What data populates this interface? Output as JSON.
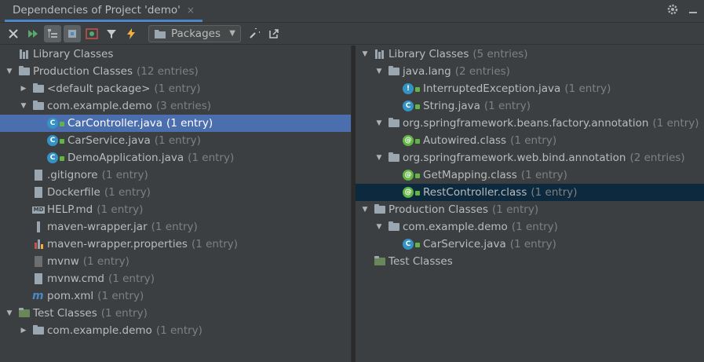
{
  "titlebar": {
    "tab_label": "Dependencies of Project 'demo'",
    "tab_close": "×"
  },
  "toolbar": {
    "scope_label": "Packages"
  },
  "left_tree": [
    {
      "name": "Library Classes",
      "count": "",
      "icon": "library-icon",
      "depth": 0,
      "arrow": ""
    },
    {
      "name": "Production Classes",
      "count": "(12 entries)",
      "icon": "folder-icon",
      "depth": 0,
      "arrow": "down"
    },
    {
      "name": "<default package>",
      "count": "(1 entry)",
      "icon": "package-folder-icon",
      "depth": 1,
      "arrow": "right"
    },
    {
      "name": "com.example.demo",
      "count": "(3 entries)",
      "icon": "package-folder-icon",
      "depth": 1,
      "arrow": "down"
    },
    {
      "name": "CarController.java",
      "count": "(1 entry)",
      "icon": "class-icon",
      "depth": 2,
      "arrow": "",
      "selected": true
    },
    {
      "name": "CarService.java",
      "count": "(1 entry)",
      "icon": "class-icon",
      "depth": 2,
      "arrow": ""
    },
    {
      "name": "DemoApplication.java",
      "count": "(1 entry)",
      "icon": "class-icon",
      "depth": 2,
      "arrow": ""
    },
    {
      "name": ".gitignore",
      "count": "(1 entry)",
      "icon": "file-icon",
      "depth": 1,
      "arrow": ""
    },
    {
      "name": "Dockerfile",
      "count": "(1 entry)",
      "icon": "file-icon",
      "depth": 1,
      "arrow": ""
    },
    {
      "name": "HELP.md",
      "count": "(1 entry)",
      "icon": "markdown-icon",
      "depth": 1,
      "arrow": ""
    },
    {
      "name": "maven-wrapper.jar",
      "count": "(1 entry)",
      "icon": "jar-icon",
      "depth": 1,
      "arrow": ""
    },
    {
      "name": "maven-wrapper.properties",
      "count": "(1 entry)",
      "icon": "properties-icon",
      "depth": 1,
      "arrow": ""
    },
    {
      "name": "mvnw",
      "count": "(1 entry)",
      "icon": "shell-icon",
      "depth": 1,
      "arrow": ""
    },
    {
      "name": "mvnw.cmd",
      "count": "(1 entry)",
      "icon": "file-icon",
      "depth": 1,
      "arrow": ""
    },
    {
      "name": "pom.xml",
      "count": "(1 entry)",
      "icon": "maven-icon",
      "depth": 1,
      "arrow": ""
    },
    {
      "name": "Test Classes",
      "count": "(1 entry)",
      "icon": "test-folder-icon",
      "depth": 0,
      "arrow": "down"
    },
    {
      "name": "com.example.demo",
      "count": "(1 entry)",
      "icon": "package-folder-icon",
      "depth": 1,
      "arrow": "right"
    }
  ],
  "right_tree": [
    {
      "name": "Library Classes",
      "count": "(5 entries)",
      "icon": "library-icon",
      "depth": 0,
      "arrow": "down"
    },
    {
      "name": "java.lang",
      "count": "(2 entries)",
      "icon": "package-folder-icon",
      "depth": 1,
      "arrow": "down"
    },
    {
      "name": "InterruptedException.java",
      "count": "(1 entry)",
      "icon": "exception-class-icon",
      "depth": 2,
      "arrow": ""
    },
    {
      "name": "String.java",
      "count": "(1 entry)",
      "icon": "class-icon",
      "depth": 2,
      "arrow": ""
    },
    {
      "name": "org.springframework.beans.factory.annotation",
      "count": "(1 entry)",
      "icon": "package-folder-icon",
      "depth": 1,
      "arrow": "down"
    },
    {
      "name": "Autowired.class",
      "count": "(1 entry)",
      "icon": "annotation-icon",
      "depth": 2,
      "arrow": ""
    },
    {
      "name": "org.springframework.web.bind.annotation",
      "count": "(2 entries)",
      "icon": "package-folder-icon",
      "depth": 1,
      "arrow": "down"
    },
    {
      "name": "GetMapping.class",
      "count": "(1 entry)",
      "icon": "annotation-icon",
      "depth": 2,
      "arrow": ""
    },
    {
      "name": "RestController.class",
      "count": "(1 entry)",
      "icon": "annotation-icon",
      "depth": 2,
      "arrow": "",
      "selected": true
    },
    {
      "name": "Production Classes",
      "count": "(1 entry)",
      "icon": "folder-icon",
      "depth": 0,
      "arrow": "down"
    },
    {
      "name": "com.example.demo",
      "count": "(1 entry)",
      "icon": "package-folder-icon",
      "depth": 1,
      "arrow": "down"
    },
    {
      "name": "CarService.java",
      "count": "(1 entry)",
      "icon": "class-icon",
      "depth": 2,
      "arrow": ""
    },
    {
      "name": "Test Classes",
      "count": "",
      "icon": "test-folder-icon",
      "depth": 0,
      "arrow": ""
    }
  ],
  "colors": {
    "background": "#3c3f41",
    "selection_left": "#4b6eaf",
    "selection_right": "#0d293e",
    "accent_blue": "#4a88c7",
    "class_blue": "#3592c4",
    "green": "#62b543"
  }
}
